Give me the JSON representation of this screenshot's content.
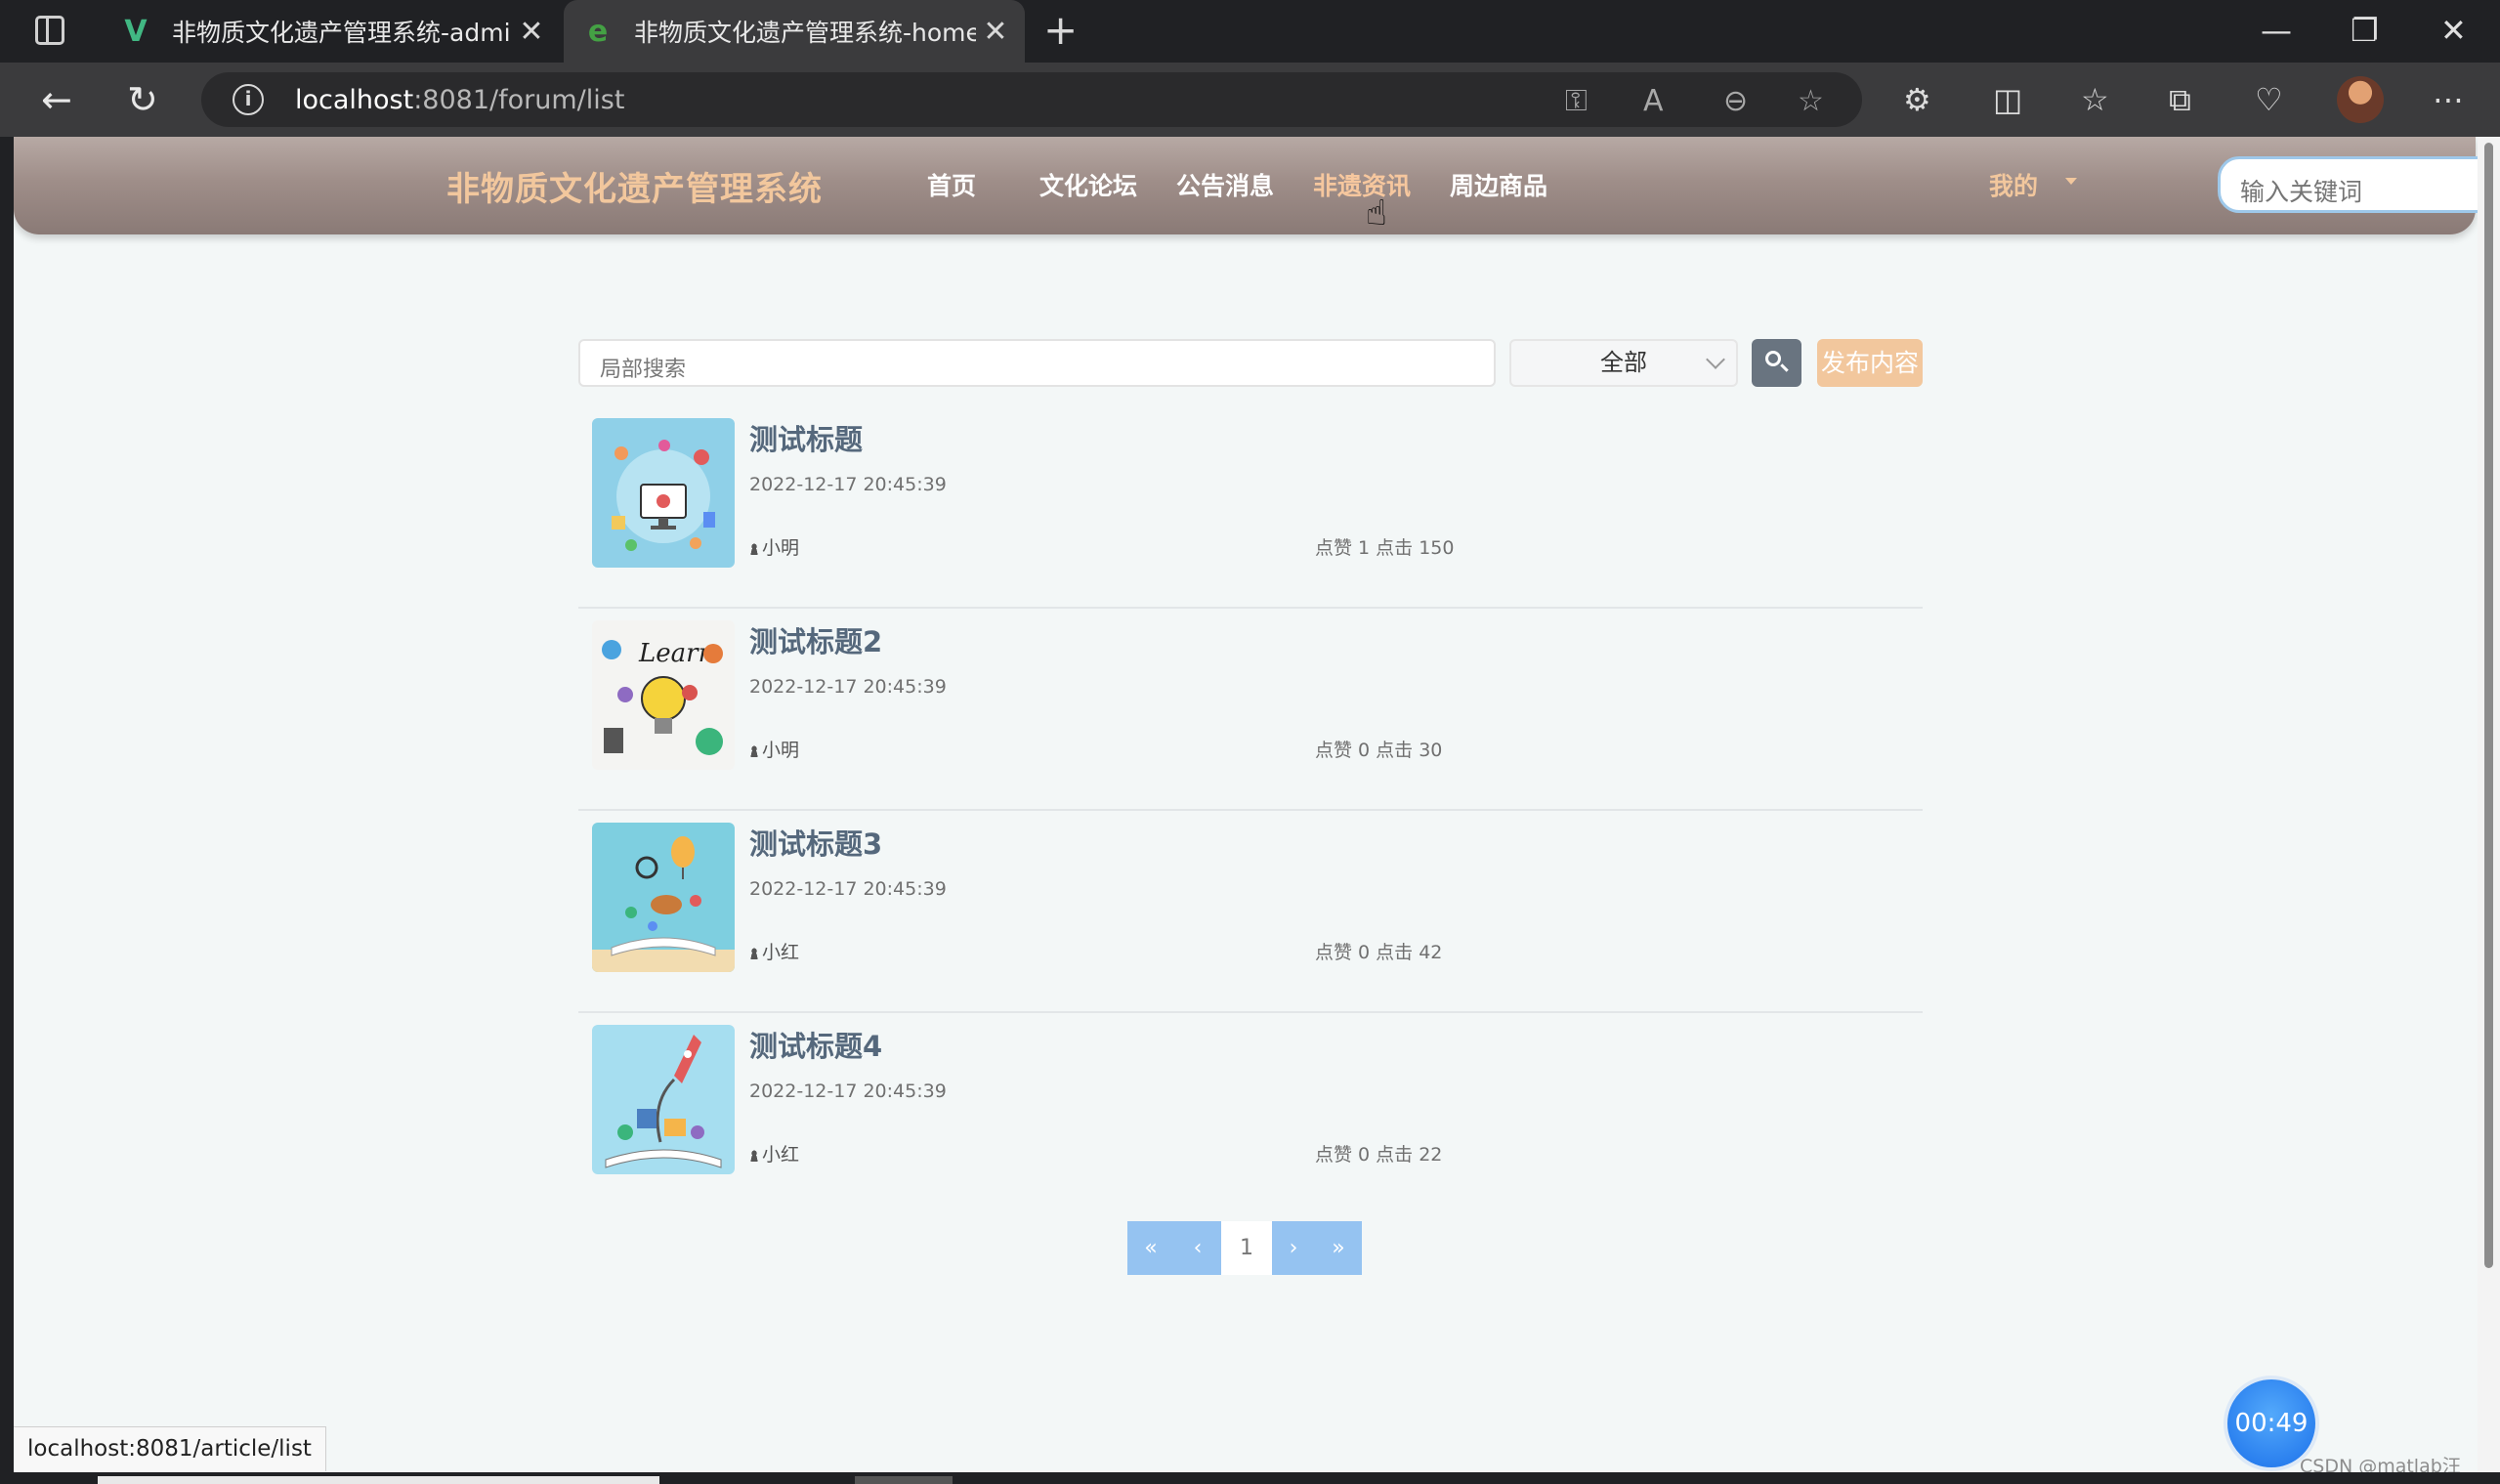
{
  "browser": {
    "tabs": [
      {
        "title": "非物质文化遗产管理系统-admin",
        "active": false,
        "favicon": "vue-icon"
      },
      {
        "title": "非物质文化遗产管理系统-home",
        "active": true,
        "favicon": "edge-icon"
      }
    ],
    "url_host": "localhost",
    "url_rest": ":8081/forum/list",
    "status_url": "localhost:8081/article/list"
  },
  "site": {
    "title": "非物质文化遗产管理系统",
    "nav": [
      "首页",
      "文化论坛",
      "公告消息",
      "非遗资讯",
      "周边商品"
    ],
    "hovered_nav": "非遗资讯",
    "my_menu": "我的",
    "search_placeholder": "输入关键词",
    "accent_color": "#f2c79d",
    "header_color": "#9f8e89"
  },
  "forum": {
    "search_placeholder": "局部搜索",
    "filter_selected": "全部",
    "publish_label": "发布内容",
    "posts": [
      {
        "title": "测试标题",
        "date": "2022-12-17 20:45:39",
        "author": "小明",
        "stats": "点赞 1 点击 150"
      },
      {
        "title": "测试标题2",
        "date": "2022-12-17 20:45:39",
        "author": "小明",
        "stats": "点赞 0 点击 30"
      },
      {
        "title": "测试标题3",
        "date": "2022-12-17 20:45:39",
        "author": "小红",
        "stats": "点赞 0 点击 42"
      },
      {
        "title": "测试标题4",
        "date": "2022-12-17 20:45:39",
        "author": "小红",
        "stats": "点赞 0 点击 22"
      }
    ],
    "pagination": {
      "first": "«",
      "prev": "‹",
      "current": "1",
      "next": "›",
      "last": "»"
    }
  },
  "overlay": {
    "timer": "00:49",
    "watermark": "CSDN @matlab汪汪队"
  }
}
